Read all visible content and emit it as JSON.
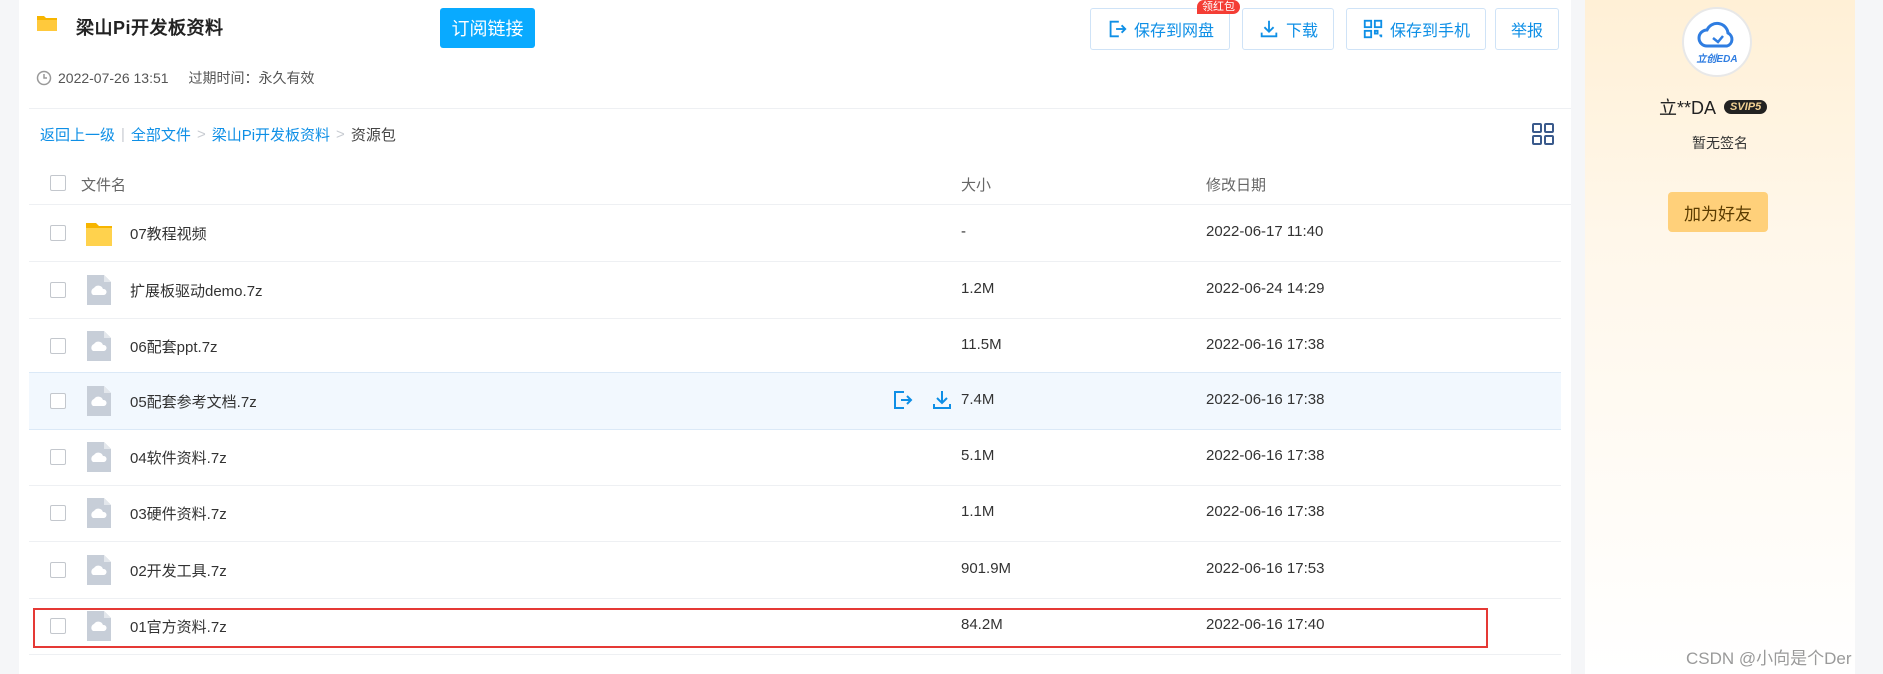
{
  "header": {
    "title": "梁山Pi开发板资料",
    "subscribe_label": "订阅链接",
    "save_to_disk_label": "保存到网盘",
    "red_envelope_tag": "领红包",
    "download_label": "下载",
    "save_to_phone_label": "保存到手机",
    "report_label": "举报",
    "created_at": "2022-07-26 13:51",
    "expire_text": "过期时间：永久有效"
  },
  "breadcrumb": {
    "back": "返回上一级",
    "bar": "|",
    "all_files": "全部文件",
    "sep": ">",
    "folder": "梁山Pi开发板资料",
    "current": "资源包"
  },
  "table": {
    "headers": {
      "name": "文件名",
      "size": "大小",
      "date": "修改日期"
    },
    "rows": [
      {
        "name": "07教程视频",
        "size": "-",
        "date": "2022-06-17 11:40",
        "type": "folder"
      },
      {
        "name": "扩展板驱动demo.7z",
        "size": "1.2M",
        "date": "2022-06-24 14:29",
        "type": "file"
      },
      {
        "name": "06配套ppt.7z",
        "size": "11.5M",
        "date": "2022-06-16 17:38",
        "type": "file"
      },
      {
        "name": "05配套参考文档.7z",
        "size": "7.4M",
        "date": "2022-06-16 17:38",
        "type": "file"
      },
      {
        "name": "04软件资料.7z",
        "size": "5.1M",
        "date": "2022-06-16 17:38",
        "type": "file"
      },
      {
        "name": "03硬件资料.7z",
        "size": "1.1M",
        "date": "2022-06-16 17:38",
        "type": "file"
      },
      {
        "name": "02开发工具.7z",
        "size": "901.9M",
        "date": "2022-06-16 17:53",
        "type": "file"
      },
      {
        "name": "01官方资料.7z",
        "size": "84.2M",
        "date": "2022-06-16 17:40",
        "type": "file"
      }
    ]
  },
  "sidebar": {
    "avatar_text": "立创EDA",
    "username": "立**DA",
    "vip_badge": "SVIP5",
    "signature": "暂无签名",
    "add_friend_label": "加为好友"
  },
  "watermark": "CSDN @小向是个Der",
  "colors": {
    "accent": "#09aaff",
    "link": "#0e8fe6",
    "highlight_border": "#e53935",
    "vip_gold": "#f2d193"
  }
}
